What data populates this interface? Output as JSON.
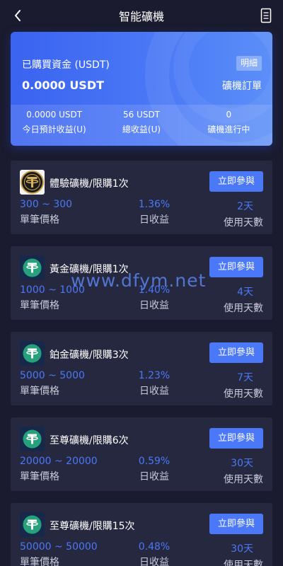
{
  "header": {
    "title": "智能礦機"
  },
  "summary": {
    "capital_label": "已購買資金 (USDT)",
    "amount": "0.0000 USDT",
    "detail_button": "明細",
    "orders_link": "礦機訂單",
    "stats": [
      {
        "value": "0.0000 USDT",
        "label": "今日預計收益(U)"
      },
      {
        "value": "56 USDT",
        "label": "總收益(U)"
      },
      {
        "value": "0",
        "label": "礦機進行中"
      }
    ]
  },
  "watermark": "www.dfym.net",
  "products": [
    {
      "name": "體驗礦機/限購1次",
      "logo": "gold-tether-icon",
      "join_label": "立即參與",
      "price_range": "300 ~ 300",
      "price_label": "單筆價格",
      "daily_rate": "1.36%",
      "daily_label": "日收益",
      "days": "2天",
      "days_label": "使用天數"
    },
    {
      "name": "黃金礦機/限購1次",
      "logo": "tether-icon",
      "join_label": "立即參與",
      "price_range": "1000 ~ 1000",
      "price_label": "單筆價格",
      "daily_rate": "1.40%",
      "daily_label": "日收益",
      "days": "4天",
      "days_label": "使用天數"
    },
    {
      "name": "鉑金礦機/限購3次",
      "logo": "tether-icon",
      "join_label": "立即參與",
      "price_range": "5000 ~ 5000",
      "price_label": "單筆價格",
      "daily_rate": "1.23%",
      "daily_label": "日收益",
      "days": "7天",
      "days_label": "使用天數"
    },
    {
      "name": "至尊礦機/限購6次",
      "logo": "tether-icon",
      "join_label": "立即參與",
      "price_range": "20000 ~ 20000",
      "price_label": "單筆價格",
      "daily_rate": "0.59%",
      "daily_label": "日收益",
      "days": "30天",
      "days_label": "使用天數"
    },
    {
      "name": "至尊礦機/限購15次",
      "logo": "tether-icon",
      "join_label": "立即參與",
      "price_range": "50000 ~ 50000",
      "price_label": "單筆價格",
      "daily_rate": "0.48%",
      "daily_label": "日收益",
      "days": "30天",
      "days_label": "使用天數"
    }
  ],
  "colors": {
    "accent": "#4a78f6",
    "background": "#1a1b2e",
    "card": "#262840"
  }
}
